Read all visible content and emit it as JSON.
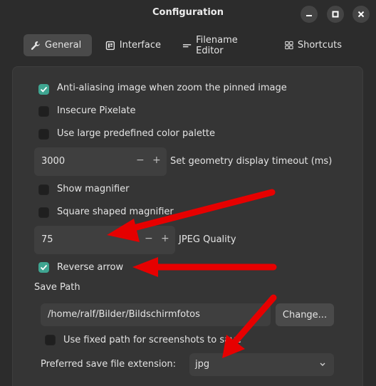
{
  "window": {
    "title": "Configuration"
  },
  "window_buttons": {
    "minimize": "–",
    "maximize": "□",
    "close": "×"
  },
  "tabs": [
    {
      "label": "General",
      "icon": "wrench-icon",
      "active": true
    },
    {
      "label": "Interface",
      "icon": "interface-icon",
      "active": false
    },
    {
      "label": "Filename Editor",
      "icon": "text-lines-icon",
      "active": false
    },
    {
      "label": "Shortcuts",
      "icon": "grid-icon",
      "active": false
    }
  ],
  "settings": {
    "antialiasing_label": "Anti-aliasing image when zoom the pinned image",
    "antialiasing_checked": true,
    "insecure_pixelate_label": "Insecure Pixelate",
    "insecure_pixelate_checked": false,
    "large_palette_label": "Use large predefined color palette",
    "large_palette_checked": false,
    "geometry_timeout_value": "3000",
    "geometry_timeout_label": "Set geometry display timeout (ms)",
    "show_magnifier_label": "Show magnifier",
    "show_magnifier_checked": false,
    "square_magnifier_label": "Square shaped magnifier",
    "square_magnifier_checked": false,
    "jpeg_quality_value": "75",
    "jpeg_quality_label": "JPEG Quality",
    "reverse_arrow_label": "Reverse arrow",
    "reverse_arrow_checked": true,
    "save_path_heading": "Save Path",
    "save_path_value": "/home/ralf/Bilder/Bildschirmfotos",
    "change_button_label": "Change...",
    "fixed_path_label": "Use fixed path for screenshots to save",
    "fixed_path_checked": false,
    "extension_label": "Preferred save file extension:",
    "extension_value": "jpg"
  },
  "spin_symbols": {
    "minus": "−",
    "plus": "+"
  },
  "colors": {
    "accent": "#3fa591",
    "annotation_arrow": "#e60000"
  }
}
